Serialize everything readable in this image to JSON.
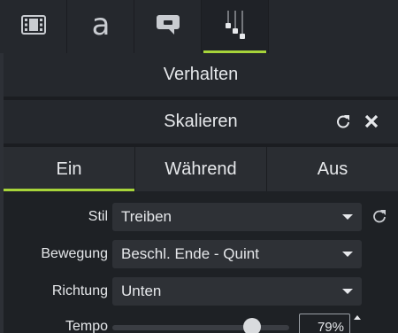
{
  "top_tabs": [
    {
      "icon": "film-icon"
    },
    {
      "icon": "annotation-text-icon"
    },
    {
      "icon": "callout-icon"
    },
    {
      "icon": "behaviors-icon",
      "active": true
    }
  ],
  "sections": {
    "verhalten": "Verhalten",
    "skalieren": "Skalieren"
  },
  "phase_tabs": [
    "Ein",
    "Während",
    "Aus"
  ],
  "active_phase": "Ein",
  "properties": {
    "stil": {
      "label": "Stil",
      "value": "Treiben"
    },
    "bewegung": {
      "label": "Bewegung",
      "value": "Beschl. Ende - Quint"
    },
    "richtung": {
      "label": "Richtung",
      "value": "Unten"
    },
    "tempo": {
      "label": "Tempo",
      "value": "79%",
      "level": 0.79
    }
  },
  "colors": {
    "accent": "#a7d43a",
    "panel": "#25282d",
    "background": "#1b1d21"
  }
}
